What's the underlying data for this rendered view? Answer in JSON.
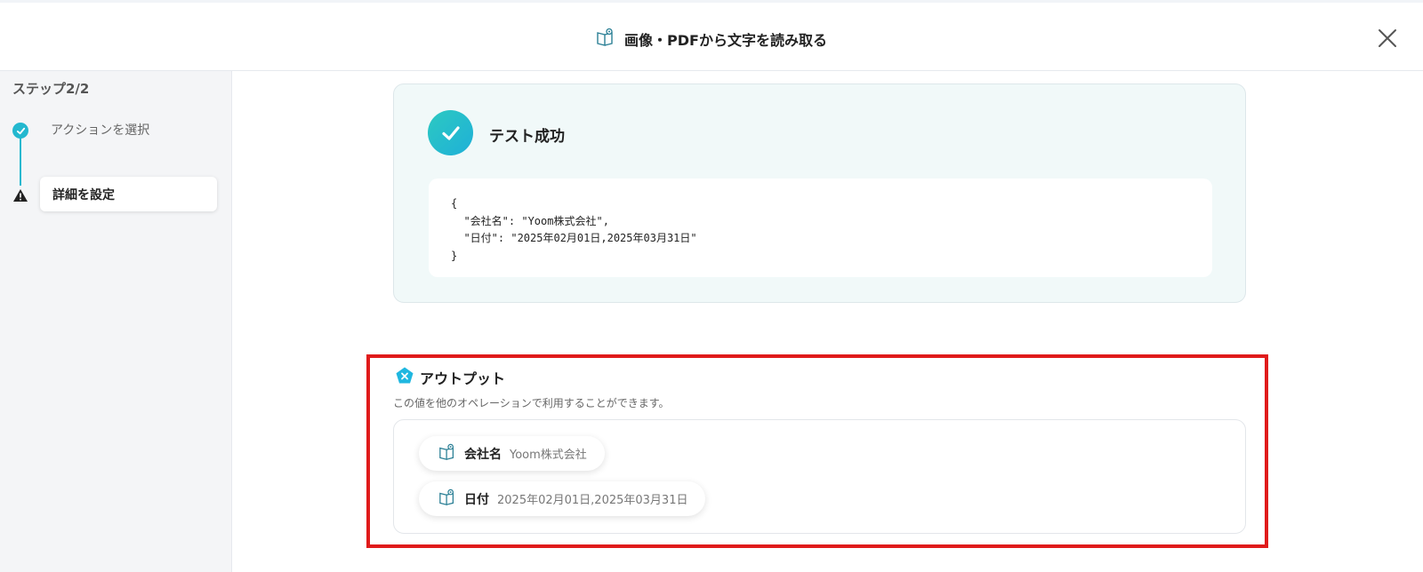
{
  "header": {
    "title": "画像・PDFから文字を読み取る",
    "title_icon": "book-scan-icon",
    "close_icon": "close-icon"
  },
  "sidebar": {
    "step_counter": "ステップ2/2",
    "steps": [
      {
        "label": "アクションを選択",
        "status": "completed",
        "icon": "check-icon"
      },
      {
        "label": "詳細を設定",
        "status": "warning",
        "icon": "warning-icon"
      }
    ]
  },
  "result": {
    "title": "テスト成功",
    "icon": "check-icon",
    "json_text": "{\n  \"会社名\": \"Yoom株式会社\",\n  \"日付\": \"2025年02月01日,2025年03月31日\"\n}"
  },
  "output": {
    "title": "アウトプット",
    "icon": "variable-x-icon",
    "description": "この値を他のオペレーションで利用することができます。",
    "items": [
      {
        "key": "会社名",
        "value": "Yoom株式会社"
      },
      {
        "key": "日付",
        "value": "2025年02月01日,2025年03月31日"
      }
    ]
  },
  "colors": {
    "accent": "#23b8cf",
    "highlight": "#e01b1b",
    "success_card_bg": "#f1f9f9"
  }
}
